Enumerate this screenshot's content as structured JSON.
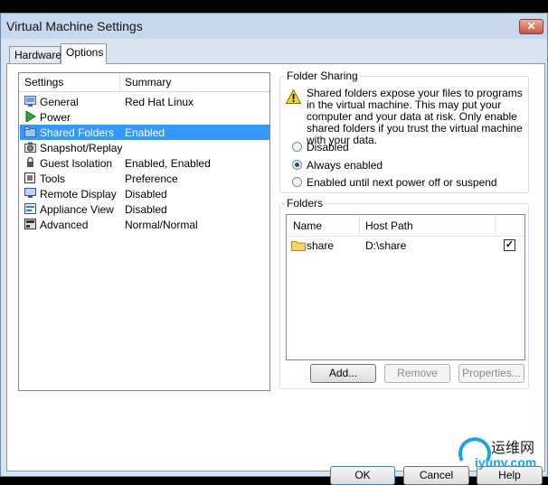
{
  "window": {
    "title": "Virtual Machine Settings",
    "close_glyph": "✕"
  },
  "tabs": [
    {
      "label": "Hardware"
    },
    {
      "label": "Options",
      "active": true
    }
  ],
  "settings": {
    "header": {
      "settings": "Settings",
      "summary": "Summary"
    },
    "items": [
      {
        "label": "General",
        "summary": "Red Hat Linux",
        "icon": "general-icon"
      },
      {
        "label": "Power",
        "summary": "",
        "icon": "power-icon"
      },
      {
        "label": "Shared Folders",
        "summary": "Enabled",
        "icon": "shared-folders-icon",
        "selected": true
      },
      {
        "label": "Snapshot/Replay",
        "summary": "",
        "icon": "snapshot-icon"
      },
      {
        "label": "Guest Isolation",
        "summary": "Enabled, Enabled",
        "icon": "guest-isolation-icon"
      },
      {
        "label": "Tools",
        "summary": "Preference",
        "icon": "tools-icon"
      },
      {
        "label": "Remote Display",
        "summary": "Disabled",
        "icon": "remote-display-icon"
      },
      {
        "label": "Appliance View",
        "summary": "Disabled",
        "icon": "appliance-view-icon"
      },
      {
        "label": "Advanced",
        "summary": "Normal/Normal",
        "icon": "advanced-icon"
      }
    ]
  },
  "folder_sharing": {
    "title": "Folder Sharing",
    "warning": "Shared folders expose your files to programs in the virtual machine. This may put your computer and your data at risk. Only enable shared folders if you trust the virtual machine with your data.",
    "options": [
      {
        "label": "Disabled",
        "checked": false
      },
      {
        "label": "Always enabled",
        "checked": true
      },
      {
        "label": "Enabled until next power off or suspend",
        "checked": false
      }
    ]
  },
  "folders": {
    "title": "Folders",
    "columns": {
      "name": "Name",
      "host_path": "Host Path"
    },
    "rows": [
      {
        "name": "share",
        "host_path": "D:\\share",
        "enabled": true
      }
    ],
    "check_glyph": "✓",
    "buttons": {
      "add": "Add...",
      "remove": "Remove",
      "properties": "Properties..."
    }
  },
  "bottom_buttons": {
    "ok": "OK",
    "cancel": "Cancel",
    "help": "Help"
  },
  "watermark": {
    "line1": "运维网",
    "line2": "iyunv.com"
  },
  "colors": {
    "selection": "#3399ff",
    "window_bg": "#d9e4f1",
    "accent": "#1aa3e8"
  }
}
